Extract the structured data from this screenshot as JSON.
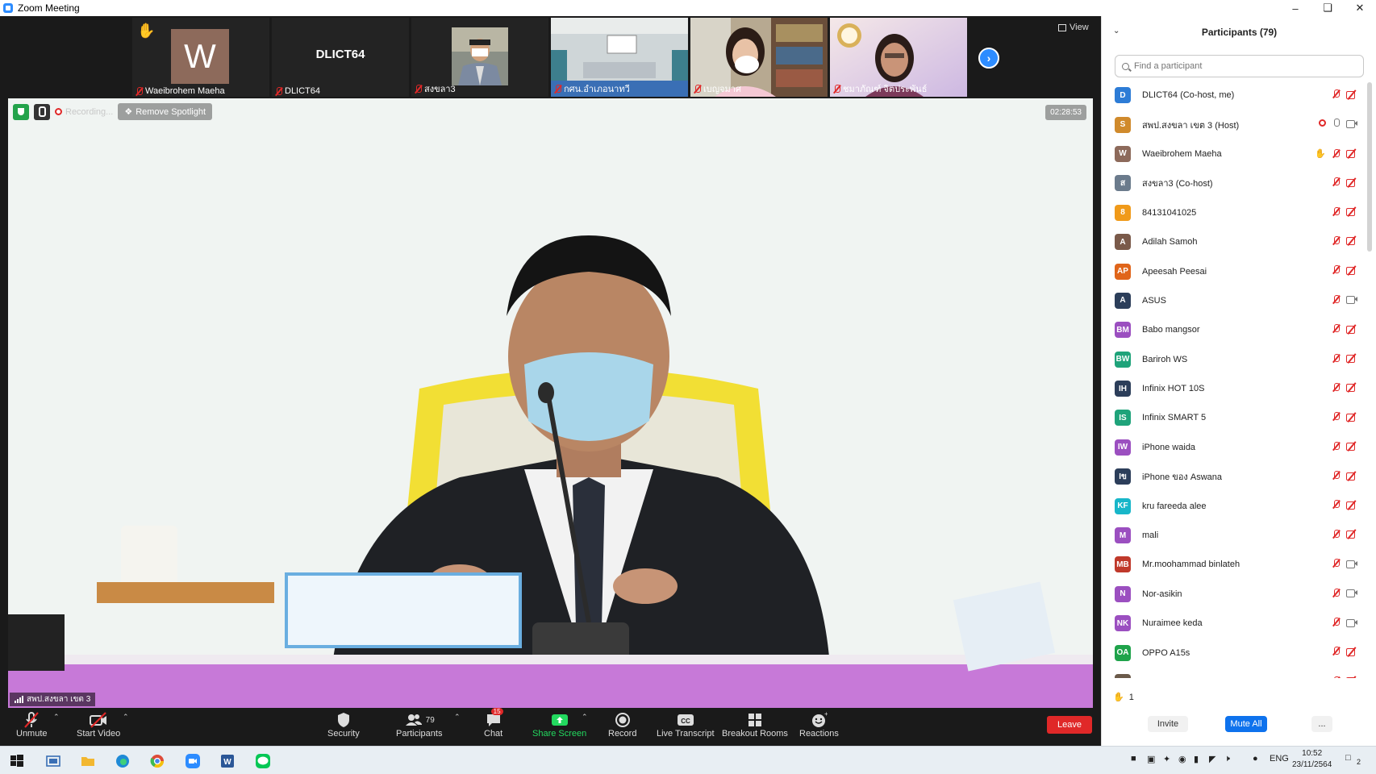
{
  "window": {
    "title": "Zoom Meeting"
  },
  "strip": {
    "tiles": [
      {
        "name": "Waeibrohem Maeha",
        "avatar_letter": "W",
        "hand_raised": true
      },
      {
        "name": "DLICT64",
        "center_label": "DLICT64"
      },
      {
        "name": "สงขลา3"
      },
      {
        "name": "กศน.อำเภอนาทวี"
      },
      {
        "name": "เบญจมาศ"
      },
      {
        "name": "ชมาภัณฑ์  จิตประพันธ์"
      }
    ],
    "view_label": "View"
  },
  "main_video": {
    "recording_label": "Recording...",
    "remove_spotlight": "Remove Spotlight",
    "timer": "02:28:53",
    "speaker_name": "สพป.สงขลา เขต 3"
  },
  "toolbar": {
    "unmute": "Unmute",
    "start_video": "Start Video",
    "security": "Security",
    "participants": "Participants",
    "participants_count": "79",
    "chat": "Chat",
    "chat_badge": "15",
    "share_screen": "Share Screen",
    "record": "Record",
    "live_transcript": "Live Transcript",
    "breakout_rooms": "Breakout Rooms",
    "reactions": "Reactions",
    "leave": "Leave",
    "colors": {
      "share_green": "#23d95f",
      "leave_red": "#e02828"
    }
  },
  "panel": {
    "title": "Participants (79)",
    "search_placeholder": "Find a participant",
    "participants": [
      {
        "name": "DLICT64 (Co-host, me)",
        "initials": "D",
        "color": "#2d7cd6",
        "mic": "off",
        "cam": "off"
      },
      {
        "name": "สพป.สงขลา เขต 3 (Host)",
        "initials": "S",
        "color": "#d08a2c",
        "mic": "on",
        "cam": "on",
        "recording": true
      },
      {
        "name": "Waeibrohem Maeha",
        "initials": "W",
        "color": "#8d6a5b",
        "mic": "off",
        "cam": "off",
        "hand": true
      },
      {
        "name": "สงขลา3 (Co-host)",
        "initials": "ส",
        "color": "#6b7b8c",
        "mic": "off",
        "cam": "off"
      },
      {
        "name": "84131041025",
        "initials": "8",
        "color": "#f09a1a",
        "mic": "off",
        "cam": "off"
      },
      {
        "name": "Adilah Samoh",
        "initials": "A",
        "color": "#7a5a4a",
        "mic": "off",
        "cam": "off"
      },
      {
        "name": "Apeesah  Peesai",
        "initials": "AP",
        "color": "#e0651a",
        "mic": "off",
        "cam": "off"
      },
      {
        "name": "ASUS",
        "initials": "A",
        "color": "#2c3e5a",
        "mic": "off",
        "cam": "on"
      },
      {
        "name": "Babo mangsor",
        "initials": "BM",
        "color": "#9b4fc0",
        "mic": "off",
        "cam": "off"
      },
      {
        "name": "Bariroh WS",
        "initials": "BW",
        "color": "#1fa37a",
        "mic": "off",
        "cam": "off"
      },
      {
        "name": "Infinix HOT 10S",
        "initials": "IH",
        "color": "#2c3e5a",
        "mic": "off",
        "cam": "off"
      },
      {
        "name": "Infinix SMART 5",
        "initials": "IS",
        "color": "#1fa37a",
        "mic": "off",
        "cam": "off"
      },
      {
        "name": "iPhone waida",
        "initials": "IW",
        "color": "#9b4fc0",
        "mic": "off",
        "cam": "off"
      },
      {
        "name": "iPhone ของ Aswana",
        "initials": "Iข",
        "color": "#2c3e5a",
        "mic": "off",
        "cam": "off"
      },
      {
        "name": "kru fareeda alee",
        "initials": "KF",
        "color": "#18b6c9",
        "mic": "off",
        "cam": "off"
      },
      {
        "name": "mali",
        "initials": "M",
        "color": "#9b4fc0",
        "mic": "off",
        "cam": "off"
      },
      {
        "name": "Mr.moohammad binlateh",
        "initials": "MB",
        "color": "#c0392b",
        "mic": "off",
        "cam": "on"
      },
      {
        "name": "Nor-asikin",
        "initials": "N",
        "color": "#9b4fc0",
        "mic": "off",
        "cam": "on"
      },
      {
        "name": "Nuraimee  keda",
        "initials": "NK",
        "color": "#9b4fc0",
        "mic": "off",
        "cam": "on"
      },
      {
        "name": "OPPO A15s",
        "initials": "OA",
        "color": "#1fa34b",
        "mic": "off",
        "cam": "off"
      },
      {
        "name": "",
        "initials": "",
        "color": "#6b5a4a",
        "mic": "off",
        "cam": "off"
      }
    ],
    "raised_hands_count": "1",
    "invite": "Invite",
    "mute_all": "Mute All",
    "more": "..."
  },
  "taskbar": {
    "language": "ENG",
    "time": "10:52",
    "date": "23/11/2564",
    "notifications": "2"
  }
}
